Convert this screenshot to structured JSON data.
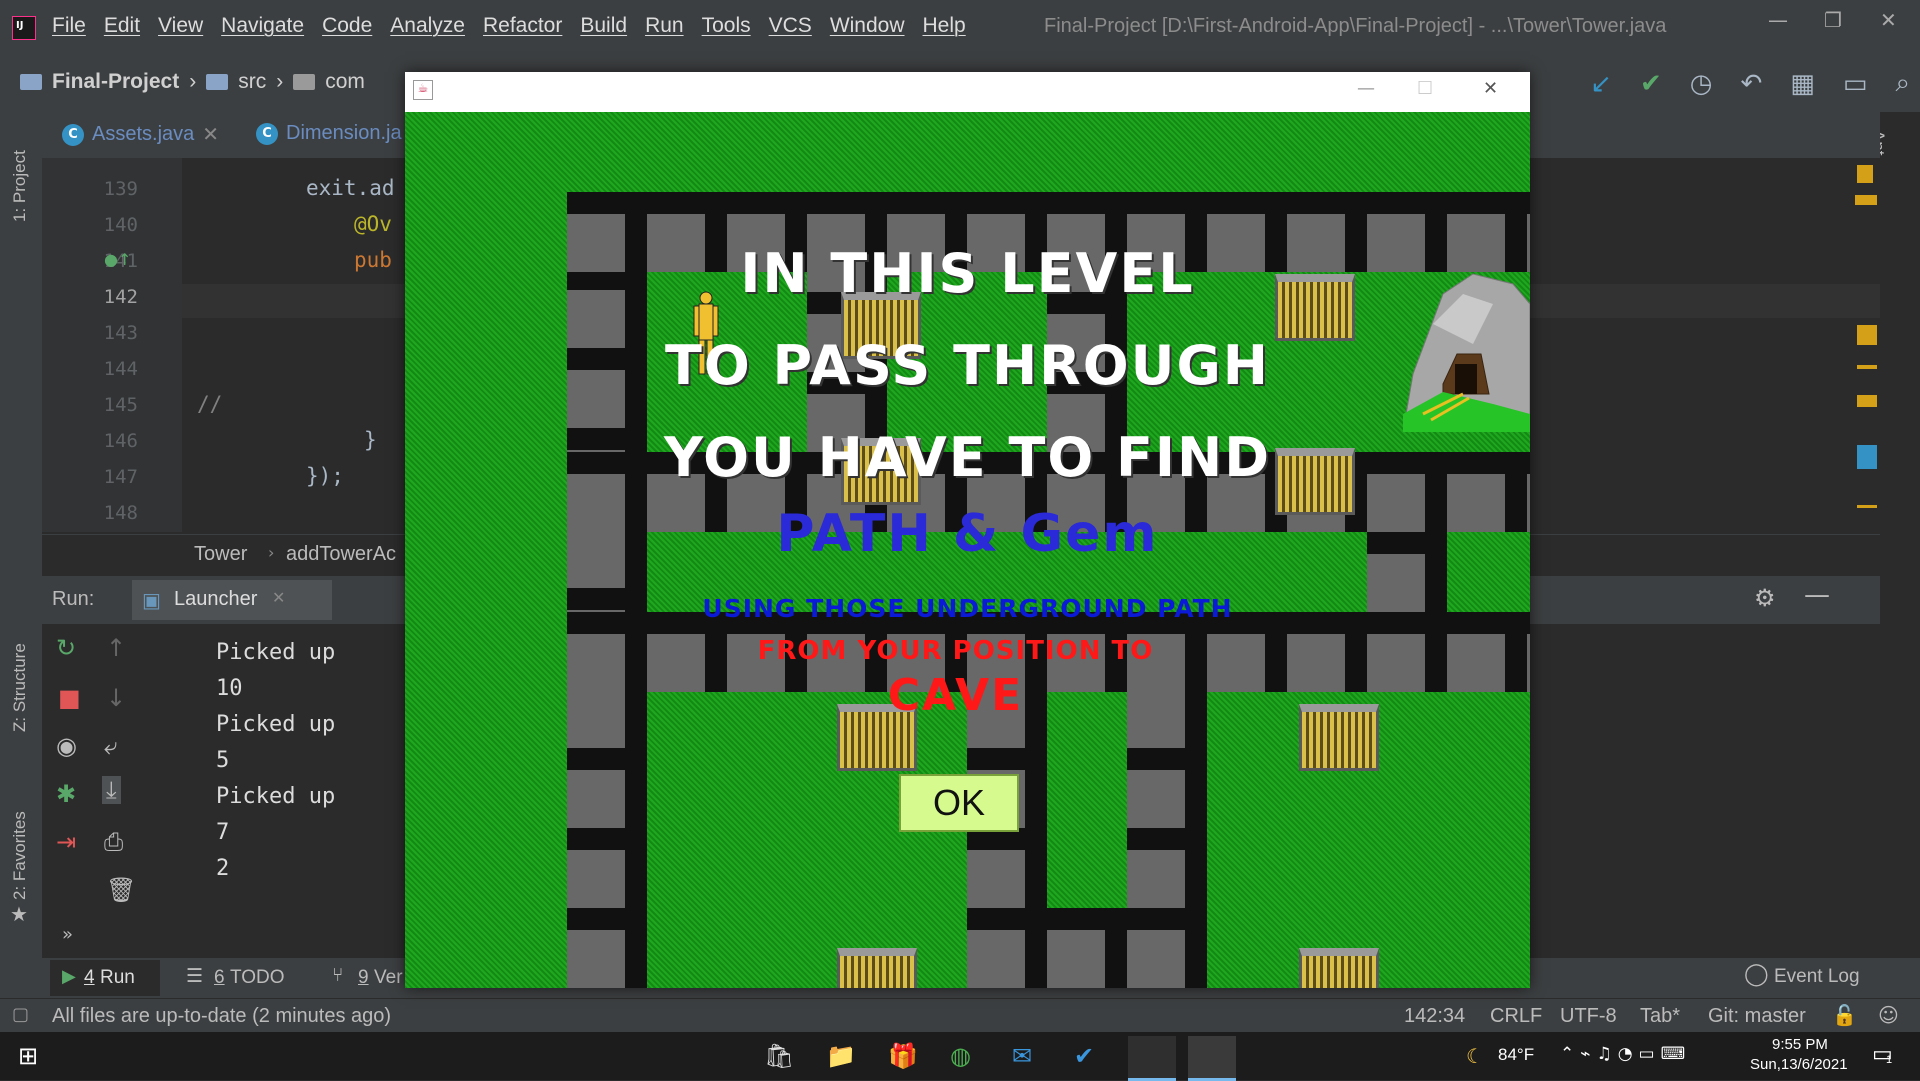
{
  "ide": {
    "menu": [
      "File",
      "Edit",
      "View",
      "Navigate",
      "Code",
      "Analyze",
      "Refactor",
      "Build",
      "Run",
      "Tools",
      "VCS",
      "Window",
      "Help"
    ],
    "window_title": "Final-Project [D:\\First-Android-App\\Final-Project] - ...\\Tower\\Tower.java",
    "breadcrumbs": [
      "Final-Project",
      "src",
      "com"
    ],
    "tabs": [
      {
        "label": "Assets.java"
      },
      {
        "label": "Dimension.ja"
      }
    ],
    "side_labels": {
      "project": "1: Project",
      "structure": "Z: Structure",
      "favorites": "2: Favorites",
      "ant": "Ant"
    },
    "code_lines": [
      {
        "n": "139",
        "text": "exit.ad"
      },
      {
        "n": "140",
        "text": "@Ov"
      },
      {
        "n": "141",
        "text": "pub"
      },
      {
        "n": "142",
        "text": ""
      },
      {
        "n": "143",
        "text": ""
      },
      {
        "n": "144",
        "text": ""
      },
      {
        "n": "145",
        "text": "//"
      },
      {
        "n": "146",
        "text": "}"
      },
      {
        "n": "147",
        "text": "});"
      },
      {
        "n": "148",
        "text": ""
      }
    ],
    "editor_crumbs": [
      "Tower",
      "addTowerAc"
    ],
    "run_panel": {
      "label": "Run:",
      "tab": "Launcher"
    },
    "console_lines": [
      "Picked up",
      "10",
      "Picked up",
      "5",
      "Picked up",
      "7",
      "2"
    ],
    "bottom_tabs": [
      {
        "num": "4",
        "label": "Run"
      },
      {
        "num": "6",
        "label": "TODO"
      },
      {
        "num": "9",
        "label": "Ver"
      }
    ],
    "event_log": "Event Log",
    "status": {
      "message": "All files are up-to-date (2 minutes ago)",
      "position": "142:34",
      "line_sep": "CRLF",
      "encoding": "UTF-8",
      "indent": "Tab*",
      "git": "Git: master"
    }
  },
  "taskbar": {
    "weather": "84°F",
    "time": "9:55 PM",
    "date": "Sun,13/6/2021",
    "notifications": "1"
  },
  "game": {
    "lines": {
      "l1": "IN THIS LEVEL",
      "l2": "TO PASS THROUGH",
      "l3": "YOU HAVE TO FIND",
      "l4": "PATH & Gem",
      "l5": "USING THOSE UNDERGROUND PATH",
      "l6": "FROM YOUR POSITION TO",
      "l7": "CAVE"
    },
    "ok_label": "OK"
  },
  "colors": {
    "ide_bg": "#2b2b2b",
    "ide_panel": "#3c3f41",
    "grass": "#169c16",
    "ok_button": "#d7fa8e",
    "msg_blue": "#2a2ad8",
    "msg_red": "#ff1818"
  }
}
